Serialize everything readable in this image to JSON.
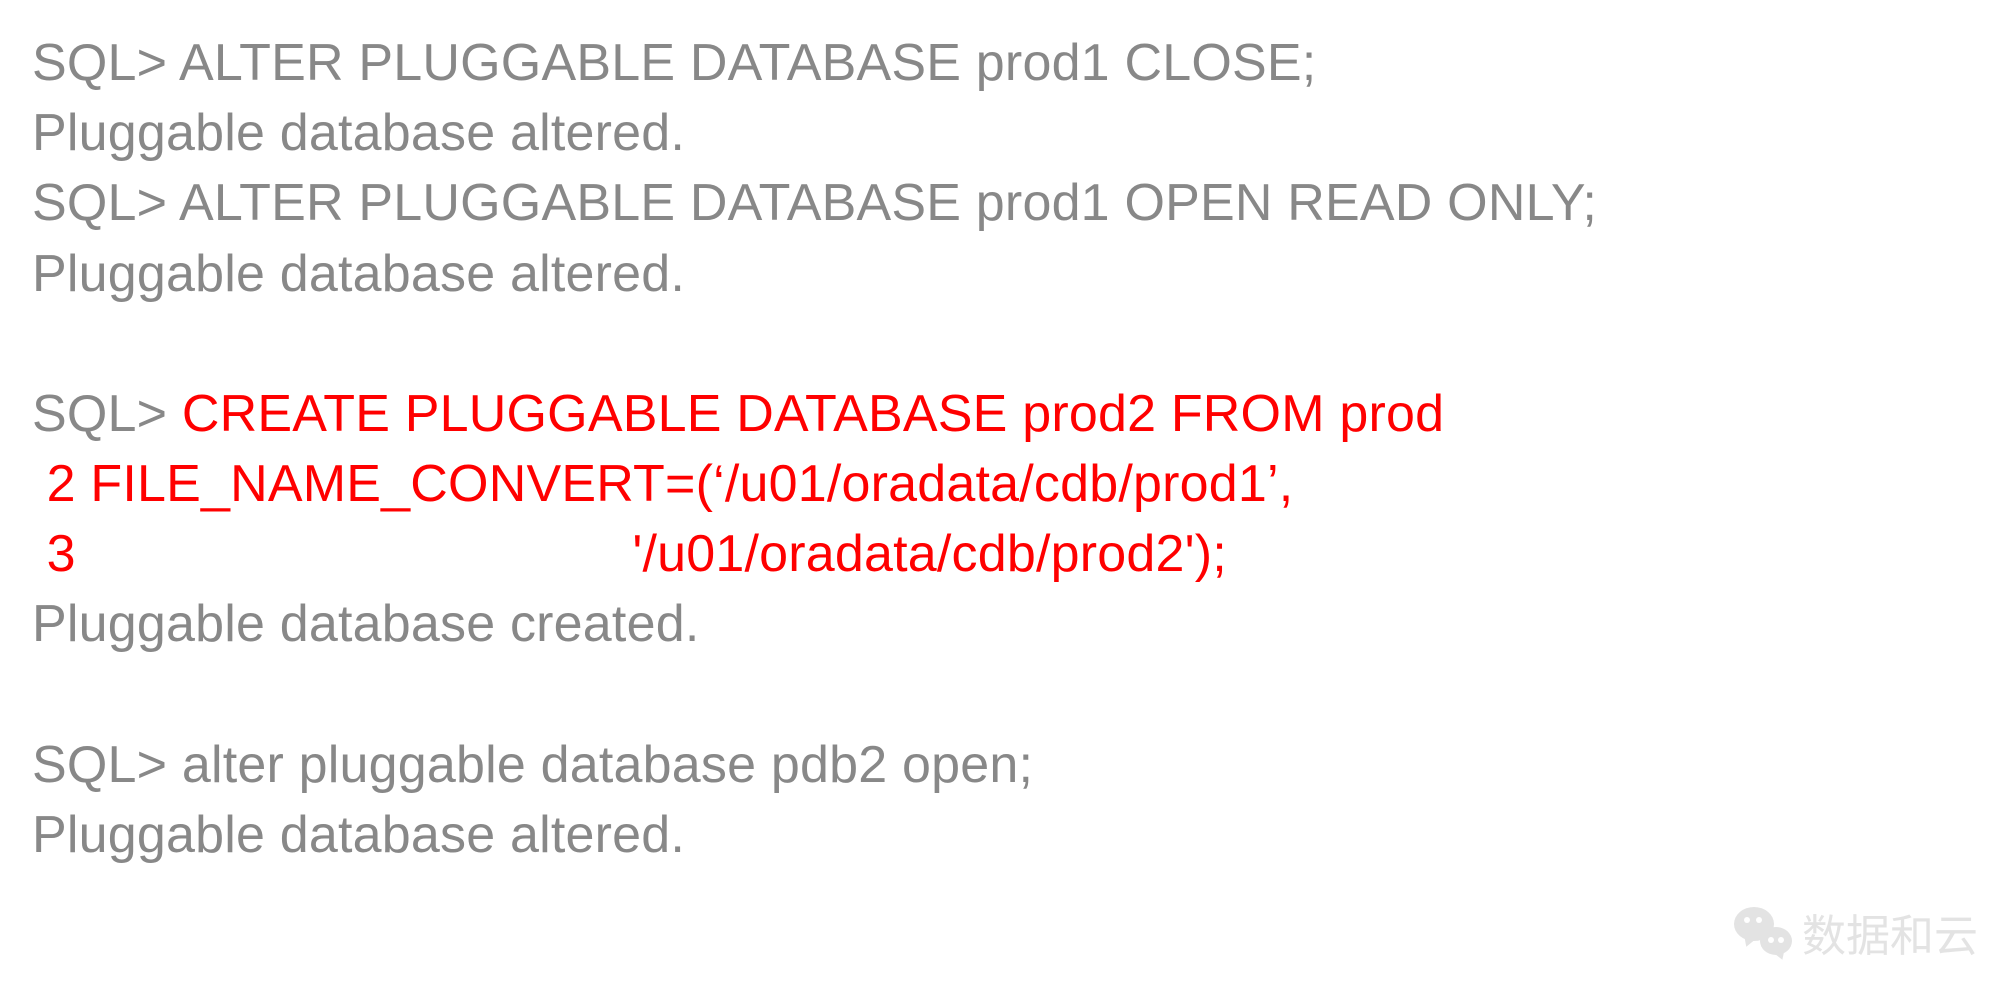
{
  "lines": {
    "l1_prompt": "SQL> ",
    "l1_cmd": "ALTER PLUGGABLE DATABASE prod1 CLOSE;",
    "l2": "Pluggable database altered.",
    "l3_prompt": "SQL> ",
    "l3_cmd": "ALTER PLUGGABLE DATABASE prod1 OPEN READ ONLY;",
    "l4": "Pluggable database altered.",
    "l5_prompt": "SQL> ",
    "l5_cmd": "CREATE PLUGGABLE DATABASE prod2 FROM prod",
    "l6": " 2 FILE_NAME_CONVERT=(‘/u01/oradata/cdb/prod1’,",
    "l7": " 3                                      '/u01/oradata/cdb/prod2');",
    "l8": "Pluggable database created.",
    "l9_prompt": "SQL> ",
    "l9_cmd": "alter pluggable database pdb2 open;",
    "l10": "Pluggable database altered."
  },
  "watermark": {
    "icon": "wechat-icon",
    "text": "数据和云"
  }
}
